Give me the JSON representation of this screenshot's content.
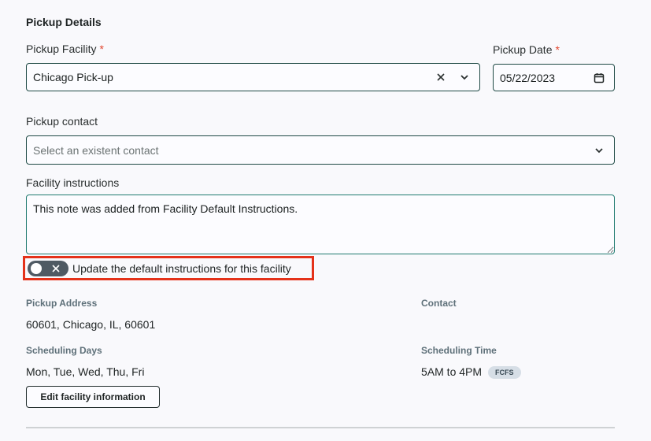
{
  "section": {
    "title": "Pickup Details"
  },
  "facility": {
    "label": "Pickup Facility",
    "required_mark": "*",
    "value": "Chicago Pick-up",
    "clear_icon": "close-icon",
    "dropdown_icon": "chevron-down-icon"
  },
  "date": {
    "label": "Pickup Date",
    "required_mark": "*",
    "value": "05/22/2023",
    "icon": "calendar-icon"
  },
  "contact": {
    "label": "Pickup contact",
    "placeholder": "Select an existent contact",
    "dropdown_icon": "chevron-down-icon"
  },
  "instructions": {
    "label": "Facility instructions",
    "value": "This note was added from Facility Default Instructions."
  },
  "toggle": {
    "label": "Update the default instructions for this facility",
    "state": "off"
  },
  "info": {
    "pickup_address_label": "Pickup Address",
    "pickup_address_value": "60601, Chicago, IL, 60601",
    "contact_label": "Contact",
    "scheduling_days_label": "Scheduling Days",
    "scheduling_days_value": "Mon, Tue, Wed, Thu, Fri",
    "scheduling_time_label": "Scheduling Time",
    "scheduling_time_value": "5AM to 4PM",
    "scheduling_badge": "FCFS"
  },
  "actions": {
    "edit_label": "Edit facility information"
  },
  "colors": {
    "accent_border": "#1f4a45",
    "highlight": "#e4321a",
    "required": "#e2452d"
  }
}
